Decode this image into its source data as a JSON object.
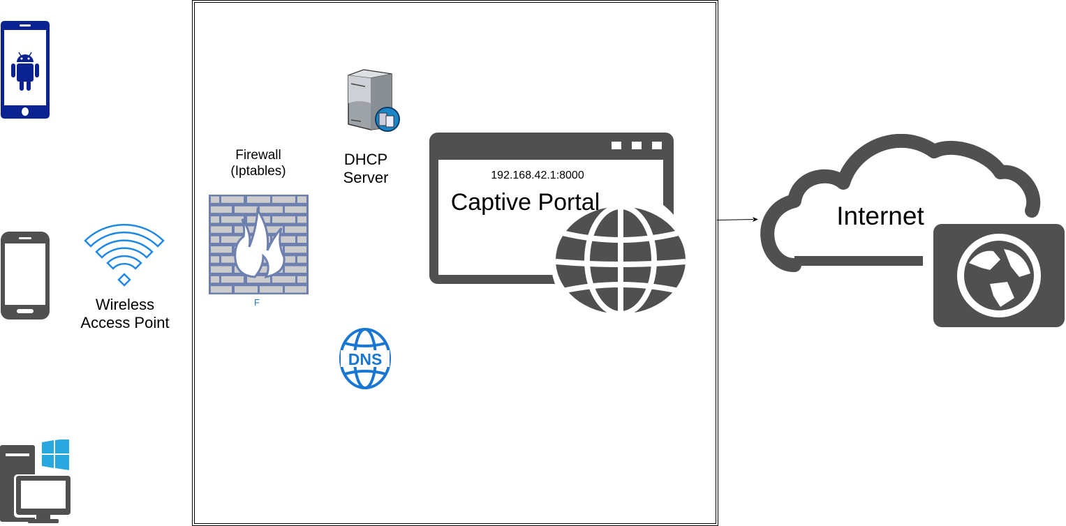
{
  "colors": {
    "device_blue": "#0b2390",
    "icon_gray": "#505050",
    "wifi_blue": "#1e88e5",
    "dns_blue": "#1976d2",
    "firewall_blue": "#6d80b0",
    "brick_gray": "#cccccc",
    "windows_blue": "#29a8e0"
  },
  "clients": [
    {
      "icon": "android-phone-icon"
    },
    {
      "icon": "smartphone-icon"
    },
    {
      "icon": "windows-desktop-icon"
    }
  ],
  "access_point": {
    "icon": "wifi-icon",
    "label_line1": "Wireless",
    "label_line2": "Access Point"
  },
  "firewall": {
    "icon": "firewall-icon",
    "label_line1": "Firewall",
    "label_line2": "(Iptables)",
    "caption": "F"
  },
  "dhcp": {
    "icon": "server-icon",
    "label_line1": "DHCP",
    "label_line2": "Server"
  },
  "dns": {
    "icon": "dns-globe-icon",
    "text": "DNS"
  },
  "portal": {
    "icon": "browser-globe-icon",
    "address": "192.168.42.1:8000",
    "title": "Captive Portal"
  },
  "internet": {
    "icon": "cloud-globe-icon",
    "label": "Internet"
  }
}
